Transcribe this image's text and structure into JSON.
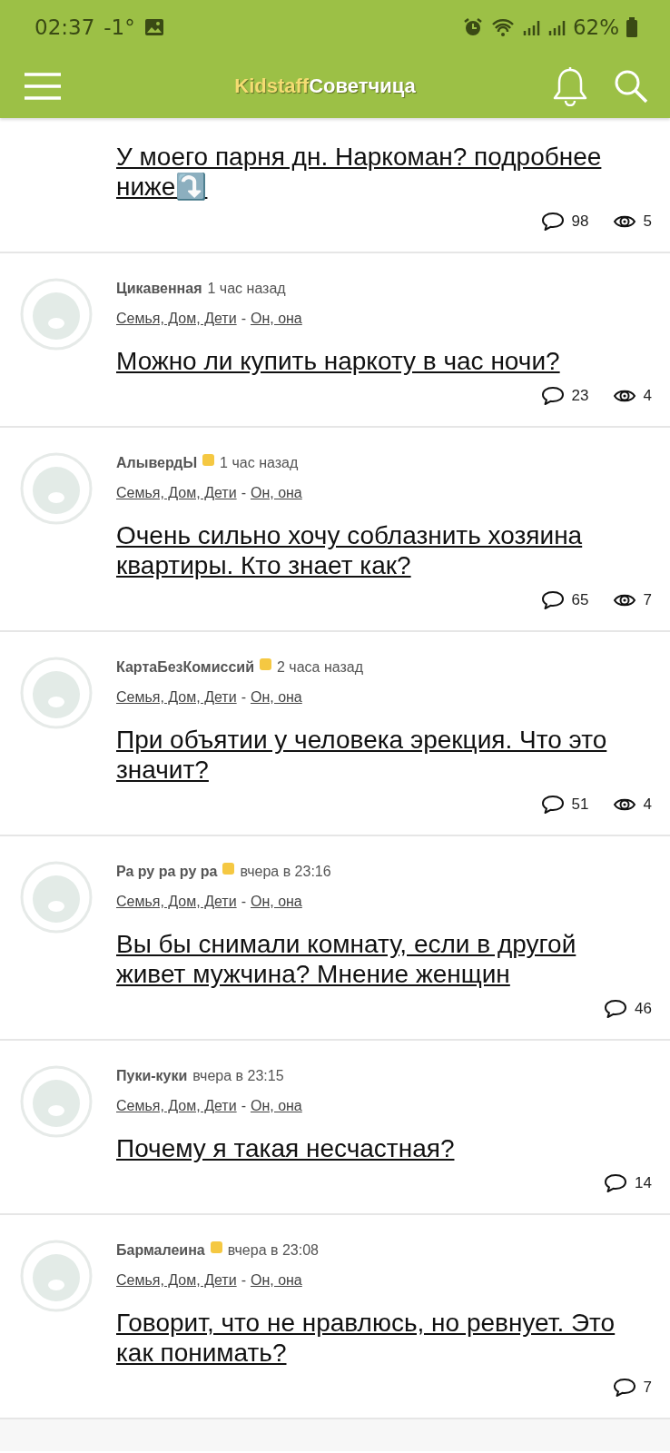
{
  "status_bar": {
    "time": "02:37",
    "temperature": "-1°",
    "battery": "62%"
  },
  "header": {
    "logo_part_1": "Kidstaff",
    "logo_part_2": "Советчица"
  },
  "posts": [
    {
      "title": "У моего парня дн. Наркоман? подробнее ниже⤵️",
      "comments": "98",
      "views": "5"
    },
    {
      "author": "Цикавенная",
      "badge": false,
      "time": "1 час назад",
      "category": "Семья, Дом, Дети",
      "separator": "-",
      "subcategory": "Он, она",
      "title": "Можно ли купить наркоту в час ночи?",
      "comments": "23",
      "views": "4"
    },
    {
      "author": "АлывердЫ",
      "badge": true,
      "time": "1 час назад",
      "category": "Семья, Дом, Дети",
      "separator": "-",
      "subcategory": "Он, она",
      "title": "Очень сильно хочу соблазнить хозяина квартиры. Кто знает как?",
      "comments": "65",
      "views": "7"
    },
    {
      "author": "КартаБезКомиссий",
      "badge": true,
      "time": "2 часа назад",
      "category": "Семья, Дом, Дети",
      "separator": "-",
      "subcategory": "Он, она",
      "title": "При объятии у человека эрекция. Что это значит?",
      "comments": "51",
      "views": "4"
    },
    {
      "author": "Ра ру ра ру ра",
      "badge": true,
      "time": "вчера в 23:16",
      "category": "Семья, Дом, Дети",
      "separator": "-",
      "subcategory": "Он, она",
      "title": "Вы бы снимали комнату, если в другой живет мужчина? Мнение женщин",
      "comments": "46"
    },
    {
      "author": "Пуки-куки",
      "badge": false,
      "time": "вчера в 23:15",
      "category": "Семья, Дом, Дети",
      "separator": "-",
      "subcategory": "Он, она",
      "title": "Почему я такая несчастная?",
      "comments": "14"
    },
    {
      "author": "Бармалеина",
      "badge": true,
      "time": "вчера в 23:08",
      "category": "Семья, Дом, Дети",
      "separator": "-",
      "subcategory": "Он, она",
      "title": "Говорит, что не нравлюсь, но ревнует. Это как понимать?",
      "comments": "7"
    },
    {
      "highlighted": true
    }
  ]
}
